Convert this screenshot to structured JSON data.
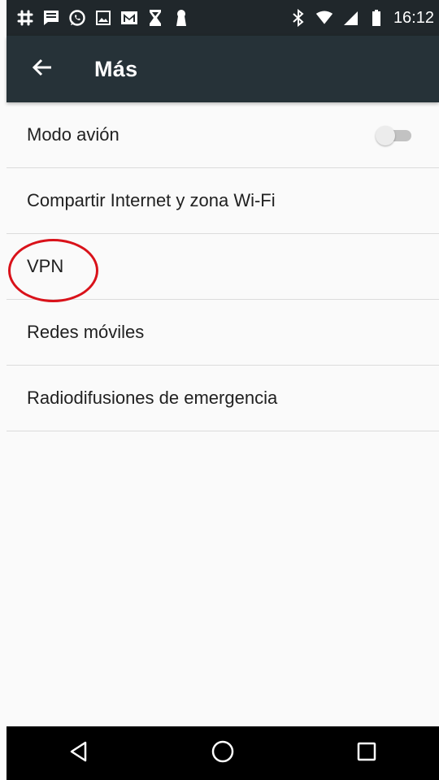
{
  "status_bar": {
    "time": "16:12",
    "left_icons": [
      "slack-icon",
      "message-icon",
      "whatsapp-icon",
      "gallery-icon",
      "gmail-icon",
      "hourglass-icon",
      "keyhole-icon"
    ],
    "right_icons": [
      "bluetooth-icon",
      "wifi-icon",
      "cellular-signal-icon",
      "battery-icon"
    ]
  },
  "app_bar": {
    "title": "Más",
    "back_icon": "arrow-back-icon",
    "color": "#263238"
  },
  "settings_list": [
    {
      "label": "Modo avión",
      "has_toggle": true,
      "toggle_on": false
    },
    {
      "label": "Compartir Internet y zona Wi-Fi"
    },
    {
      "label": "VPN",
      "highlighted": true
    },
    {
      "label": "Redes móviles"
    },
    {
      "label": "Radiodifusiones de emergencia"
    }
  ],
  "annotation": {
    "color": "#d9121a",
    "shape": "ellipse",
    "target": "VPN"
  },
  "nav_bar": {
    "buttons": [
      "back-triangle-icon",
      "home-circle-icon",
      "recents-square-icon"
    ]
  }
}
